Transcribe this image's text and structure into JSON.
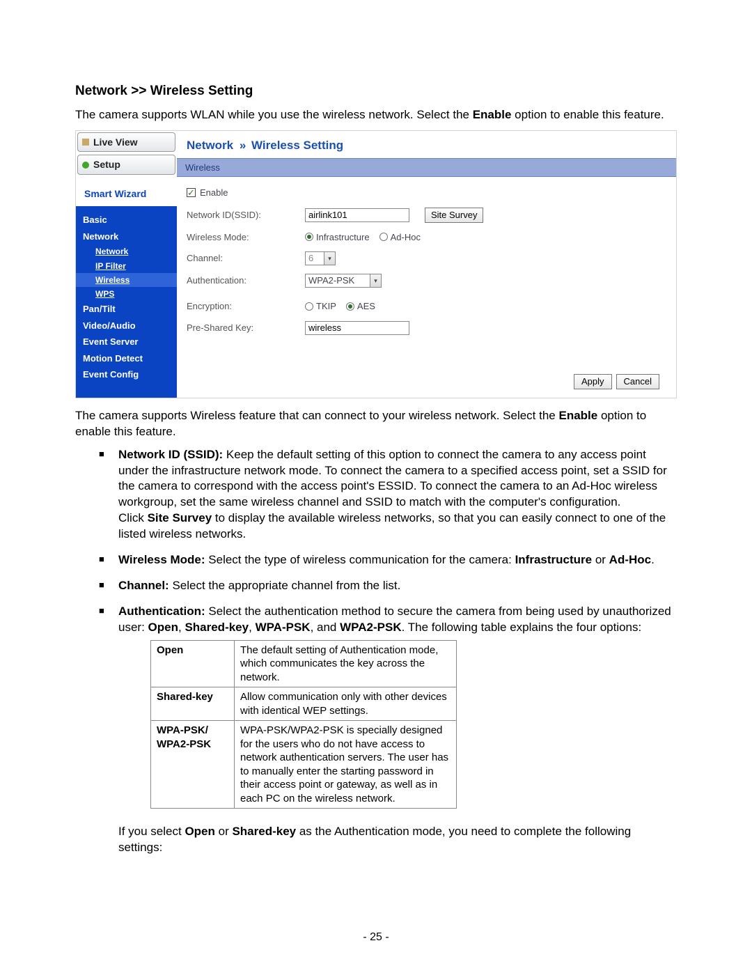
{
  "heading": "Network >> Wireless Setting",
  "intro_pre": "The camera supports WLAN while you use the wireless network. Select the ",
  "intro_bold": "Enable",
  "intro_post": " option to enable this feature.",
  "sidebar": {
    "live_view": "Live View",
    "setup": "Setup",
    "smart_wizard": "Smart Wizard",
    "items": [
      {
        "label": "Basic"
      },
      {
        "label": "Network"
      },
      {
        "label": "Network",
        "sub": true
      },
      {
        "label": "IP Filter",
        "sub": true
      },
      {
        "label": "Wireless",
        "sub": true,
        "active": true
      },
      {
        "label": "WPS",
        "sub": true
      },
      {
        "label": "Pan/Tilt"
      },
      {
        "label": "Video/Audio"
      },
      {
        "label": "Event Server"
      },
      {
        "label": "Motion Detect"
      },
      {
        "label": "Event Config"
      }
    ]
  },
  "breadcrumb": {
    "a": "Network",
    "sep": "»",
    "b": "Wireless Setting"
  },
  "section_bar": "Wireless",
  "form": {
    "enable_label": "Enable",
    "ssid_label": "Network ID(SSID):",
    "ssid_value": "airlink101",
    "site_survey": "Site Survey",
    "mode_label": "Wireless Mode:",
    "mode_infra": "Infrastructure",
    "mode_adhoc": "Ad-Hoc",
    "channel_label": "Channel:",
    "channel_value": "6",
    "auth_label": "Authentication:",
    "auth_value": "WPA2-PSK",
    "enc_label": "Encryption:",
    "enc_tkip": "TKIP",
    "enc_aes": "AES",
    "psk_label": "Pre-Shared Key:",
    "psk_value": "wireless",
    "apply": "Apply",
    "cancel": "Cancel"
  },
  "mid_pre": "The camera supports Wireless feature that can connect to your wireless network. Select the ",
  "mid_bold": "Enable",
  "mid_post": " option to enable this feature.",
  "bullets": {
    "ssid_head": "Network ID (SSID):",
    "ssid_body": " Keep the default setting of this option to connect the camera to any access point under the infrastructure network mode. To connect the camera to a specified access point, set a SSID for the camera to correspond with the access point's ESSID. To connect the camera to an Ad-Hoc wireless workgroup, set the same wireless channel and SSID to match with the computer's configuration.",
    "ssid_click_pre": "Click ",
    "ssid_click_bold": "Site Survey",
    "ssid_click_post": " to display the available wireless networks, so that you can easily connect to one of the listed wireless networks.",
    "mode_head": "Wireless Mode:",
    "mode_body_pre": " Select the type of wireless communication for the camera: ",
    "mode_infra": "Infrastructure",
    "mode_or": " or ",
    "mode_adhoc": "Ad-Hoc",
    "mode_period": ".",
    "chan_head": "Channel:",
    "chan_body": " Select the appropriate channel from the list.",
    "auth_head": "Authentication:",
    "auth_body_pre": " Select the authentication method to secure the camera from being used by unauthorized user: ",
    "auth_open": "Open",
    "auth_c1": ", ",
    "auth_shared": "Shared-key",
    "auth_c2": ", ",
    "auth_wpa": "WPA-PSK",
    "auth_c3": ", and ",
    "auth_wpa2": "WPA2-PSK",
    "auth_tail": ". The following table explains the four options:"
  },
  "table": {
    "open_k": "Open",
    "open_v": "The default setting of Authentication mode, which communicates the key across the network.",
    "shared_k": "Shared-key",
    "shared_v": "Allow communication only with other devices with identical WEP settings.",
    "wpa_k1": "WPA-PSK/",
    "wpa_k2": "WPA2-PSK",
    "wpa_v": "WPA-PSK/WPA2-PSK is specially designed for the users who do not have access to network authentication servers. The user has to manually enter the starting password in their access point or gateway, as well as in each PC on the wireless network."
  },
  "closing_pre": "If you select ",
  "closing_open": "Open",
  "closing_or": " or ",
  "closing_shared": "Shared-key",
  "closing_post": " as the Authentication mode, you need to complete the following settings:",
  "pagenum": "- 25 -"
}
